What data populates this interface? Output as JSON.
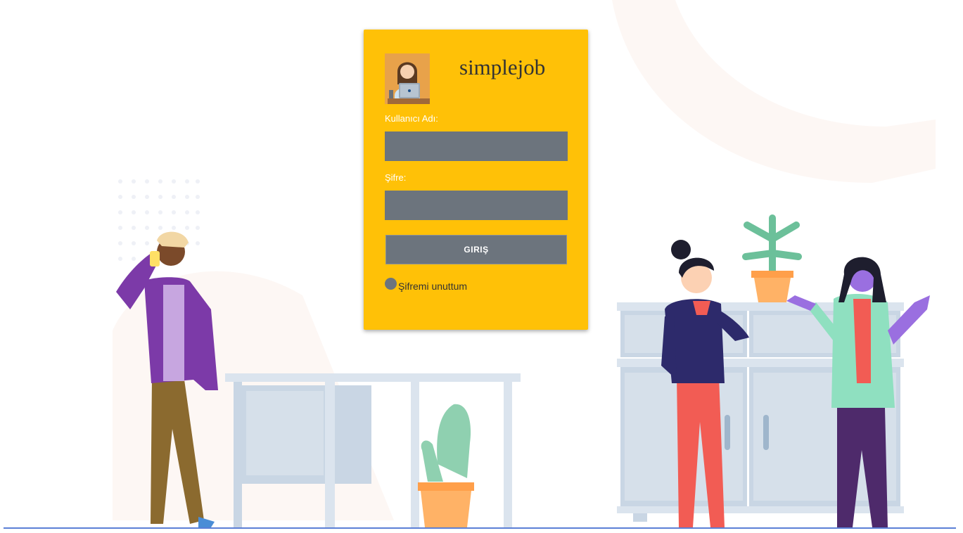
{
  "login": {
    "brand": "simplejob",
    "username_label": "Kullanıcı Adı:",
    "username_value": "",
    "password_label": "Şifre:",
    "password_value": "",
    "submit_label": "GIRIŞ",
    "forgot_label": "Şifremi unuttum"
  },
  "colors": {
    "card_background": "#ffc107",
    "input_background": "#6c747d",
    "bottom_line": "#5b7fd6"
  },
  "icons": {
    "avatar": "person-with-laptop-avatar",
    "forgot_toggle": "radio-circle"
  }
}
